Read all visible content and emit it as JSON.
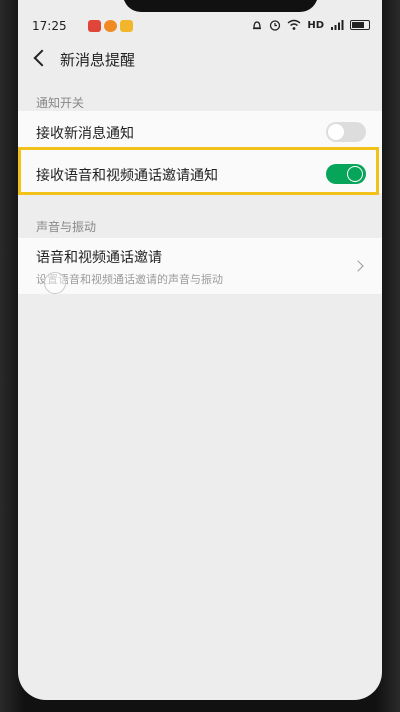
{
  "status_bar": {
    "time": "17:25",
    "network_label": "HD",
    "status_icons": [
      "alarm-icon",
      "clock-icon",
      "wifi-icon",
      "signal-icon",
      "battery-icon"
    ],
    "app_icons": [
      {
        "name": "app-icon-red",
        "color": "#e0453a"
      },
      {
        "name": "app-icon-orange",
        "color": "#f08a24"
      },
      {
        "name": "app-icon-yellow",
        "color": "#f1b62b"
      }
    ]
  },
  "header": {
    "title": "新消息提醒",
    "back_icon": "back-arrow-icon"
  },
  "sections": [
    {
      "label": "通知开关",
      "items": [
        {
          "label": "接收新消息通知",
          "toggle": false
        },
        {
          "label": "接收语音和视频通话邀请通知",
          "toggle": true,
          "highlighted": true
        }
      ]
    },
    {
      "label": "声音与振动",
      "items": [
        {
          "label": "语音和视频通话邀请",
          "sublabel": "设置语音和视频通话邀请的声音与振动"
        }
      ]
    }
  ],
  "colors": {
    "toggle_on": "#07a55a",
    "toggle_off": "#dddddd",
    "highlight_border": "#f2c21b",
    "background": "#ededed"
  }
}
